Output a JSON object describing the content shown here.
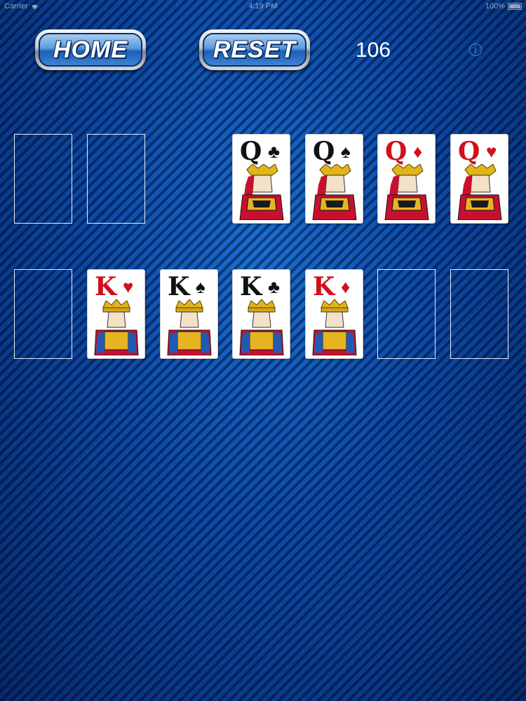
{
  "status": {
    "carrier": "Carrier",
    "time": "4:19 PM",
    "battery": "100%"
  },
  "toolbar": {
    "home_label": "HOME",
    "reset_label": "RESET",
    "score": "106",
    "info_glyph": "i"
  },
  "top_row": {
    "empty_slots": 2,
    "cards": [
      {
        "rank": "Q",
        "suit": "♣",
        "color": "black"
      },
      {
        "rank": "Q",
        "suit": "♠",
        "color": "black"
      },
      {
        "rank": "Q",
        "suit": "♦",
        "color": "red"
      },
      {
        "rank": "Q",
        "suit": "♥",
        "color": "red"
      }
    ]
  },
  "bottom_row": {
    "cards": [
      {
        "rank": "K",
        "suit": "♥",
        "color": "red"
      },
      {
        "rank": "K",
        "suit": "♠",
        "color": "black"
      },
      {
        "rank": "K",
        "suit": "♣",
        "color": "black"
      },
      {
        "rank": "K",
        "suit": "♦",
        "color": "red"
      }
    ]
  },
  "colors": {
    "red": "#d0101b",
    "black": "#111111",
    "accent": "#2f8cff",
    "table_blue": "#0b4aa6"
  }
}
